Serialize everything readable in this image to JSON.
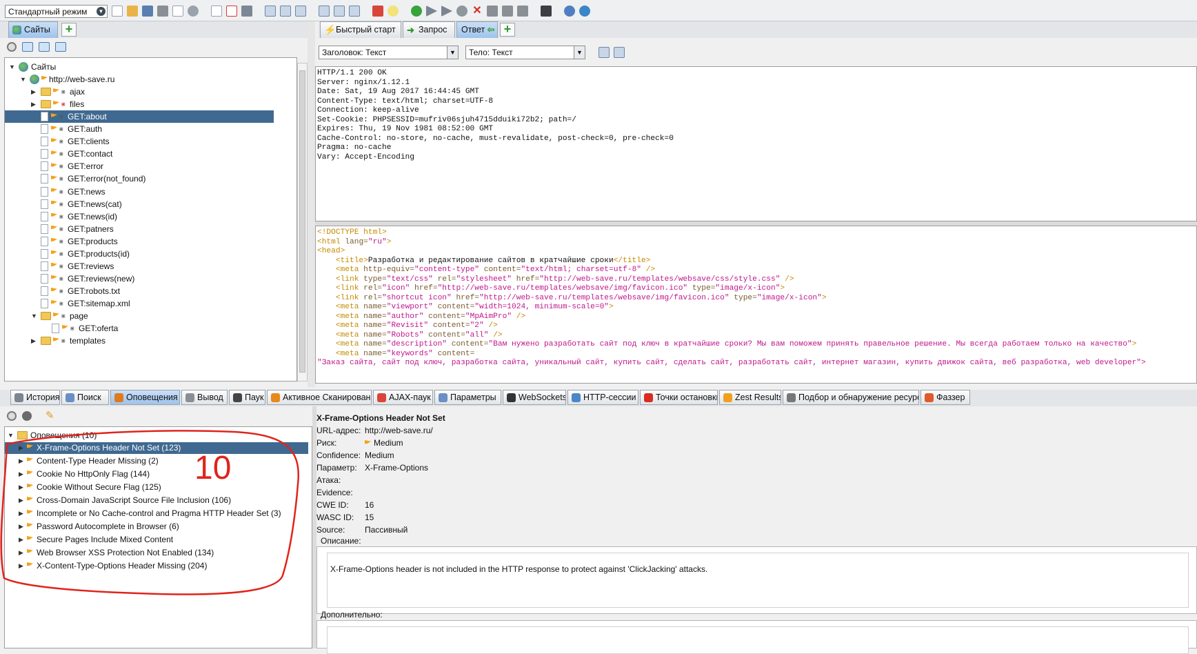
{
  "toolbar": {
    "mode": "Стандартный режим"
  },
  "sites_panel": {
    "tab_label": "Сайты",
    "tree": [
      {
        "label": "Сайты",
        "depth": 0,
        "kind": "root",
        "expanded": true
      },
      {
        "label": "http://web-save.ru",
        "depth": 1,
        "kind": "site",
        "expanded": true
      },
      {
        "label": "ajax",
        "depth": 2,
        "kind": "folder",
        "expanded": false
      },
      {
        "label": "files",
        "depth": 2,
        "kind": "folder",
        "expanded": false
      },
      {
        "label": "GET:about",
        "depth": 2,
        "kind": "file",
        "selected": true
      },
      {
        "label": "GET:auth",
        "depth": 2,
        "kind": "file"
      },
      {
        "label": "GET:clients",
        "depth": 2,
        "kind": "file"
      },
      {
        "label": "GET:contact",
        "depth": 2,
        "kind": "file"
      },
      {
        "label": "GET:error",
        "depth": 2,
        "kind": "file"
      },
      {
        "label": "GET:error(not_found)",
        "depth": 2,
        "kind": "file"
      },
      {
        "label": "GET:news",
        "depth": 2,
        "kind": "file"
      },
      {
        "label": "GET:news(cat)",
        "depth": 2,
        "kind": "file"
      },
      {
        "label": "GET:news(id)",
        "depth": 2,
        "kind": "file"
      },
      {
        "label": "GET:patners",
        "depth": 2,
        "kind": "file"
      },
      {
        "label": "GET:products",
        "depth": 2,
        "kind": "file"
      },
      {
        "label": "GET:products(id)",
        "depth": 2,
        "kind": "file"
      },
      {
        "label": "GET:reviews",
        "depth": 2,
        "kind": "file"
      },
      {
        "label": "GET:reviews(new)",
        "depth": 2,
        "kind": "file"
      },
      {
        "label": "GET:robots.txt",
        "depth": 2,
        "kind": "file"
      },
      {
        "label": "GET:sitemap.xml",
        "depth": 2,
        "kind": "file"
      },
      {
        "label": "page",
        "depth": 2,
        "kind": "folder",
        "expanded": true
      },
      {
        "label": "GET:oferta",
        "depth": 3,
        "kind": "file"
      },
      {
        "label": "templates",
        "depth": 2,
        "kind": "folder",
        "expanded": false
      }
    ]
  },
  "work_tabs": {
    "quick_start": "Быстрый старт",
    "request": "Запрос",
    "response": "Ответ"
  },
  "response_view": {
    "header_combo": "Заголовок: Текст",
    "body_combo": "Тело: Текст",
    "headers": [
      "HTTP/1.1 200 OK",
      "Server: nginx/1.12.1",
      "Date: Sat, 19 Aug 2017 16:44:45 GMT",
      "Content-Type: text/html; charset=UTF-8",
      "Connection: keep-alive",
      "Set-Cookie: PHPSESSID=mufriv06sjuh4715dduiki72b2; path=/",
      "Expires: Thu, 19 Nov 1981 08:52:00 GMT",
      "Cache-Control: no-store, no-cache, must-revalidate, post-check=0, pre-check=0",
      "Pragma: no-cache",
      "Vary: Accept-Encoding"
    ],
    "body_lines": [
      [
        {
          "t": "<!DOCTYPE html>",
          "c": "tag"
        }
      ],
      [
        {
          "t": "<html ",
          "c": "tag"
        },
        {
          "t": "lang=",
          "c": "attr"
        },
        {
          "t": "\"ru\"",
          "c": "val"
        },
        {
          "t": ">",
          "c": "tag"
        }
      ],
      [
        {
          "t": "<head>",
          "c": "tag"
        }
      ],
      [
        {
          "t": "    "
        },
        {
          "t": "<title>",
          "c": "tag"
        },
        {
          "t": "Разработка и редактирование сайтов в кратчайшие сроки",
          "c": "txt"
        },
        {
          "t": "</title>",
          "c": "tag"
        }
      ],
      [
        {
          "t": "    "
        },
        {
          "t": "<meta ",
          "c": "tag"
        },
        {
          "t": "http-equiv=",
          "c": "attr"
        },
        {
          "t": "\"content-type\" ",
          "c": "val"
        },
        {
          "t": "content=",
          "c": "attr"
        },
        {
          "t": "\"text/html; charset=utf-8\" ",
          "c": "val"
        },
        {
          "t": "/>",
          "c": "tag"
        }
      ],
      [
        {
          "t": "    "
        },
        {
          "t": "<link ",
          "c": "tag"
        },
        {
          "t": "type=",
          "c": "attr"
        },
        {
          "t": "\"text/css\" ",
          "c": "val"
        },
        {
          "t": "rel=",
          "c": "attr"
        },
        {
          "t": "\"stylesheet\" ",
          "c": "val"
        },
        {
          "t": "href=",
          "c": "attr"
        },
        {
          "t": "\"http://web-save.ru/templates/websave/css/style.css\" ",
          "c": "val"
        },
        {
          "t": "/>",
          "c": "tag"
        }
      ],
      [
        {
          "t": "    "
        },
        {
          "t": "<link ",
          "c": "tag"
        },
        {
          "t": "rel=",
          "c": "attr"
        },
        {
          "t": "\"icon\" ",
          "c": "val"
        },
        {
          "t": "href=",
          "c": "attr"
        },
        {
          "t": "\"http://web-save.ru/templates/websave/img/favicon.ico\" ",
          "c": "val"
        },
        {
          "t": "type=",
          "c": "attr"
        },
        {
          "t": "\"image/x-icon\"",
          "c": "val"
        },
        {
          "t": ">",
          "c": "tag"
        }
      ],
      [
        {
          "t": "    "
        },
        {
          "t": "<link ",
          "c": "tag"
        },
        {
          "t": "rel=",
          "c": "attr"
        },
        {
          "t": "\"shortcut icon\" ",
          "c": "val"
        },
        {
          "t": "href=",
          "c": "attr"
        },
        {
          "t": "\"http://web-save.ru/templates/websave/img/favicon.ico\" ",
          "c": "val"
        },
        {
          "t": "type=",
          "c": "attr"
        },
        {
          "t": "\"image/x-icon\"",
          "c": "val"
        },
        {
          "t": ">",
          "c": "tag"
        }
      ],
      [
        {
          "t": "    "
        },
        {
          "t": "<meta ",
          "c": "tag"
        },
        {
          "t": "name=",
          "c": "attr"
        },
        {
          "t": "\"viewport\" ",
          "c": "val"
        },
        {
          "t": "content=",
          "c": "attr"
        },
        {
          "t": "\"width=1024, minimum-scale=0\"",
          "c": "val"
        },
        {
          "t": ">",
          "c": "tag"
        }
      ],
      [
        {
          "t": "    "
        },
        {
          "t": "<meta ",
          "c": "tag"
        },
        {
          "t": "name=",
          "c": "attr"
        },
        {
          "t": "\"author\" ",
          "c": "val"
        },
        {
          "t": "content=",
          "c": "attr"
        },
        {
          "t": "\"MpAimPro\" ",
          "c": "val"
        },
        {
          "t": "/>",
          "c": "tag"
        }
      ],
      [
        {
          "t": "    "
        },
        {
          "t": "<meta ",
          "c": "tag"
        },
        {
          "t": "name=",
          "c": "attr"
        },
        {
          "t": "\"Revisit\" ",
          "c": "val"
        },
        {
          "t": "content=",
          "c": "attr"
        },
        {
          "t": "\"2\" ",
          "c": "val"
        },
        {
          "t": "/>",
          "c": "tag"
        }
      ],
      [
        {
          "t": "    "
        },
        {
          "t": "<meta ",
          "c": "tag"
        },
        {
          "t": "name=",
          "c": "attr"
        },
        {
          "t": "\"Robots\" ",
          "c": "val"
        },
        {
          "t": "content=",
          "c": "attr"
        },
        {
          "t": "\"all\" ",
          "c": "val"
        },
        {
          "t": "/>",
          "c": "tag"
        }
      ],
      [
        {
          "t": "    "
        },
        {
          "t": "<meta ",
          "c": "tag"
        },
        {
          "t": "name=",
          "c": "attr"
        },
        {
          "t": "\"description\" ",
          "c": "val"
        },
        {
          "t": "content=",
          "c": "attr"
        },
        {
          "t": "\"Вам нужено разработать сайт под ключ в кратчайшие сроки? Мы вам поможем принять правельное решение. Мы всегда работаем только на качество\"",
          "c": "val"
        },
        {
          "t": ">",
          "c": "tag"
        }
      ],
      [
        {
          "t": "    "
        },
        {
          "t": "<meta ",
          "c": "tag"
        },
        {
          "t": "name=",
          "c": "attr"
        },
        {
          "t": "\"keywords\" ",
          "c": "val"
        },
        {
          "t": "content=",
          "c": "attr"
        }
      ],
      [
        {
          "t": "\"Заказ сайта, сайт под ключ, разработка сайта, уникальный сайт, купить сайт, сделать сайт, разработать сайт, интернет магазин, купить движок сайта, веб разработка, web developer\">",
          "c": "val"
        }
      ]
    ]
  },
  "bottom_tabs": [
    "История",
    "Поиск",
    "Оповещения",
    "Вывод",
    "Паук",
    "Активное Сканирование",
    "AJAX-паук",
    "Параметры",
    "WebSockets",
    "HTTP-сессии",
    "Точки остановки",
    "Zest Results",
    "Подбор и обнаружение ресурсов",
    "Фаззер"
  ],
  "alerts": {
    "root": "Оповещения (10)",
    "items": [
      {
        "label": "X-Frame-Options Header Not Set (123)",
        "selected": true
      },
      {
        "label": "Content-Type Header Missing (2)"
      },
      {
        "label": "Cookie No HttpOnly Flag (144)"
      },
      {
        "label": "Cookie Without Secure Flag (125)"
      },
      {
        "label": "Cross-Domain JavaScript Source File Inclusion (106)"
      },
      {
        "label": "Incomplete or No Cache-control and Pragma HTTP Header Set (3)"
      },
      {
        "label": "Password Autocomplete in Browser (6)"
      },
      {
        "label": "Secure Pages Include Mixed Content"
      },
      {
        "label": "Web Browser XSS Protection Not Enabled (134)"
      },
      {
        "label": "X-Content-Type-Options Header Missing (204)"
      }
    ],
    "annotation": "10"
  },
  "alert_detail": {
    "title": "X-Frame-Options Header Not Set",
    "fields": [
      {
        "k": "URL-адрес:",
        "v": "http://web-save.ru/"
      },
      {
        "k": "Риск:",
        "v": "Medium",
        "flag": true
      },
      {
        "k": "Confidence:",
        "v": "Medium"
      },
      {
        "k": "Параметр:",
        "v": "X-Frame-Options"
      },
      {
        "k": "Атака:",
        "v": ""
      },
      {
        "k": "Evidence:",
        "v": ""
      },
      {
        "k": "CWE ID:",
        "v": "16"
      },
      {
        "k": "WASC ID:",
        "v": "15"
      },
      {
        "k": "Source:",
        "v": "Пассивный"
      }
    ],
    "description_label": "Описание:",
    "description": "X-Frame-Options header is not included in the HTTP response to protect against 'ClickJacking' attacks.",
    "extra_label": "Дополнительно:"
  },
  "colors": {
    "selection": "#3f6990",
    "tag": "#c48a00",
    "attr": "#7a5c2e",
    "val": "#c0168c",
    "annotation": "#e0241b"
  }
}
